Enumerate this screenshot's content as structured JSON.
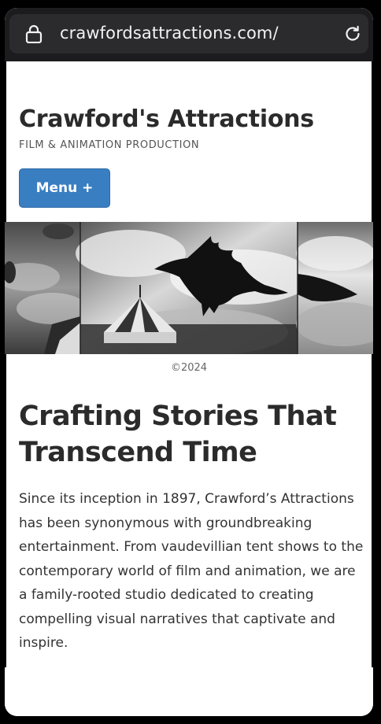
{
  "browser": {
    "url": "crawfordsattractions.com/",
    "lock_icon": "lock-icon",
    "reload_icon": "reload-icon"
  },
  "site": {
    "title": "Crawford's Attractions",
    "tagline": "FILM & ANIMATION PRODUCTION",
    "menu_label": "Menu +"
  },
  "hero": {
    "caption": "©2024"
  },
  "content": {
    "heading": "Crafting Stories That Transcend Time",
    "intro": "Since its inception in 1897, Crawford’s Attractions has been synonymous with groundbreaking entertainment. From vaudevillian tent shows to the contemporary world of film and animation, we are a family-rooted studio dedicated to creating compelling visual narratives that captivate and inspire."
  },
  "colors": {
    "accent": "#3a7ec2",
    "chrome": "#1c1c1e",
    "text": "#2b2b2b"
  }
}
